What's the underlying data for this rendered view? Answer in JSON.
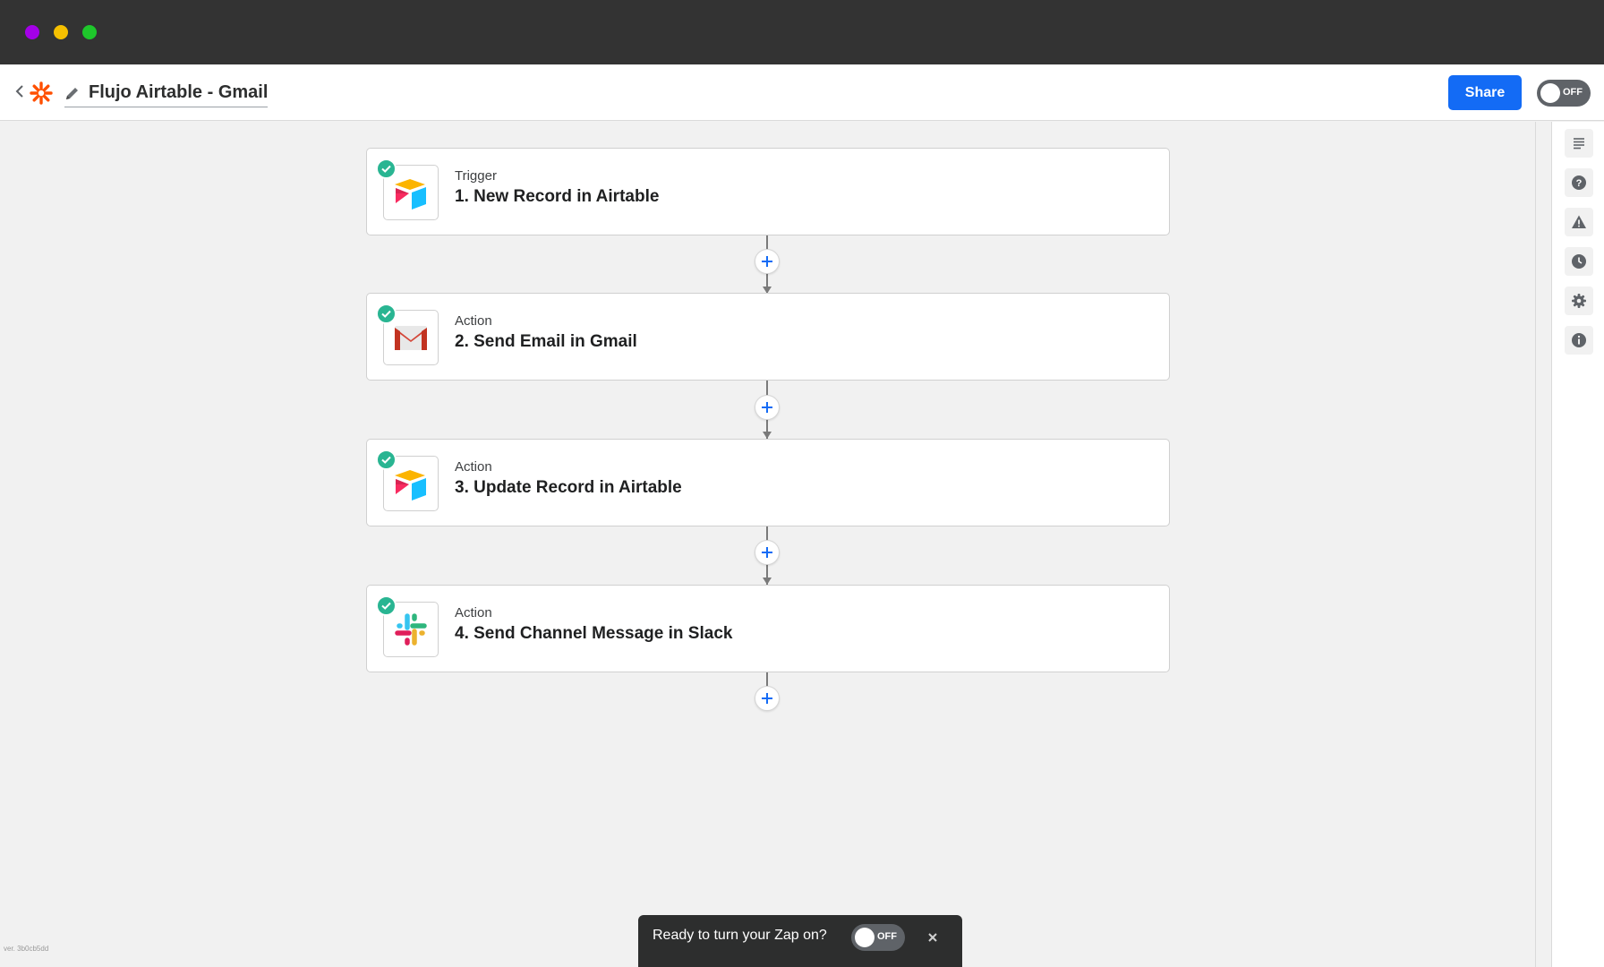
{
  "header": {
    "zap_title": "Flujo Airtable - Gmail",
    "share_label": "Share",
    "toggle_label": "OFF"
  },
  "steps": [
    {
      "type": "Trigger",
      "title": "1. New Record in Airtable",
      "app": "airtable"
    },
    {
      "type": "Action",
      "title": "2. Send Email in Gmail",
      "app": "gmail"
    },
    {
      "type": "Action",
      "title": "3. Update Record in Airtable",
      "app": "airtable"
    },
    {
      "type": "Action",
      "title": "4. Send Channel Message in Slack",
      "app": "slack"
    }
  ],
  "toast": {
    "text": "Ready to turn your Zap on?",
    "toggle_label": "OFF"
  },
  "footer": {
    "version": "ver. 3b0cb5dd"
  },
  "rail": [
    "notes-icon",
    "help-icon",
    "warning-icon",
    "history-icon",
    "settings-icon",
    "info-icon"
  ],
  "colors": {
    "titlebar": "#333333",
    "primary": "#136bf5",
    "check": "#29b592",
    "brand": "#ff4f00"
  }
}
